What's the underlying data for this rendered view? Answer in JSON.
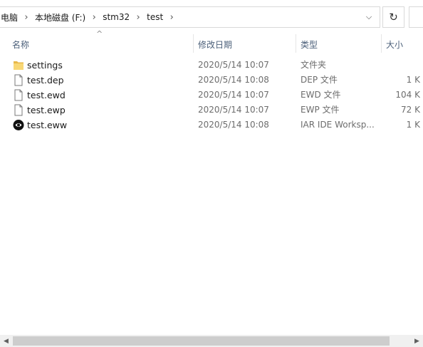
{
  "breadcrumb": [
    "电脑",
    "本地磁盘 (F:)",
    "stm32",
    "test"
  ],
  "columns": {
    "name": "名称",
    "date": "修改日期",
    "type": "类型",
    "size": "大小"
  },
  "files": [
    {
      "name": "settings",
      "date": "2020/5/14 10:07",
      "type": "文件夹",
      "size": "",
      "icon": "folder-icon"
    },
    {
      "name": "test.dep",
      "date": "2020/5/14 10:08",
      "type": "DEP 文件",
      "size": "1 K",
      "icon": "file-icon"
    },
    {
      "name": "test.ewd",
      "date": "2020/5/14 10:07",
      "type": "EWD 文件",
      "size": "104 K",
      "icon": "file-icon"
    },
    {
      "name": "test.ewp",
      "date": "2020/5/14 10:07",
      "type": "EWP 文件",
      "size": "72 K",
      "icon": "file-icon"
    },
    {
      "name": "test.eww",
      "date": "2020/5/14 10:08",
      "type": "IAR IDE Worksp...",
      "size": "1 K",
      "icon": "iar-workspace-icon"
    }
  ]
}
